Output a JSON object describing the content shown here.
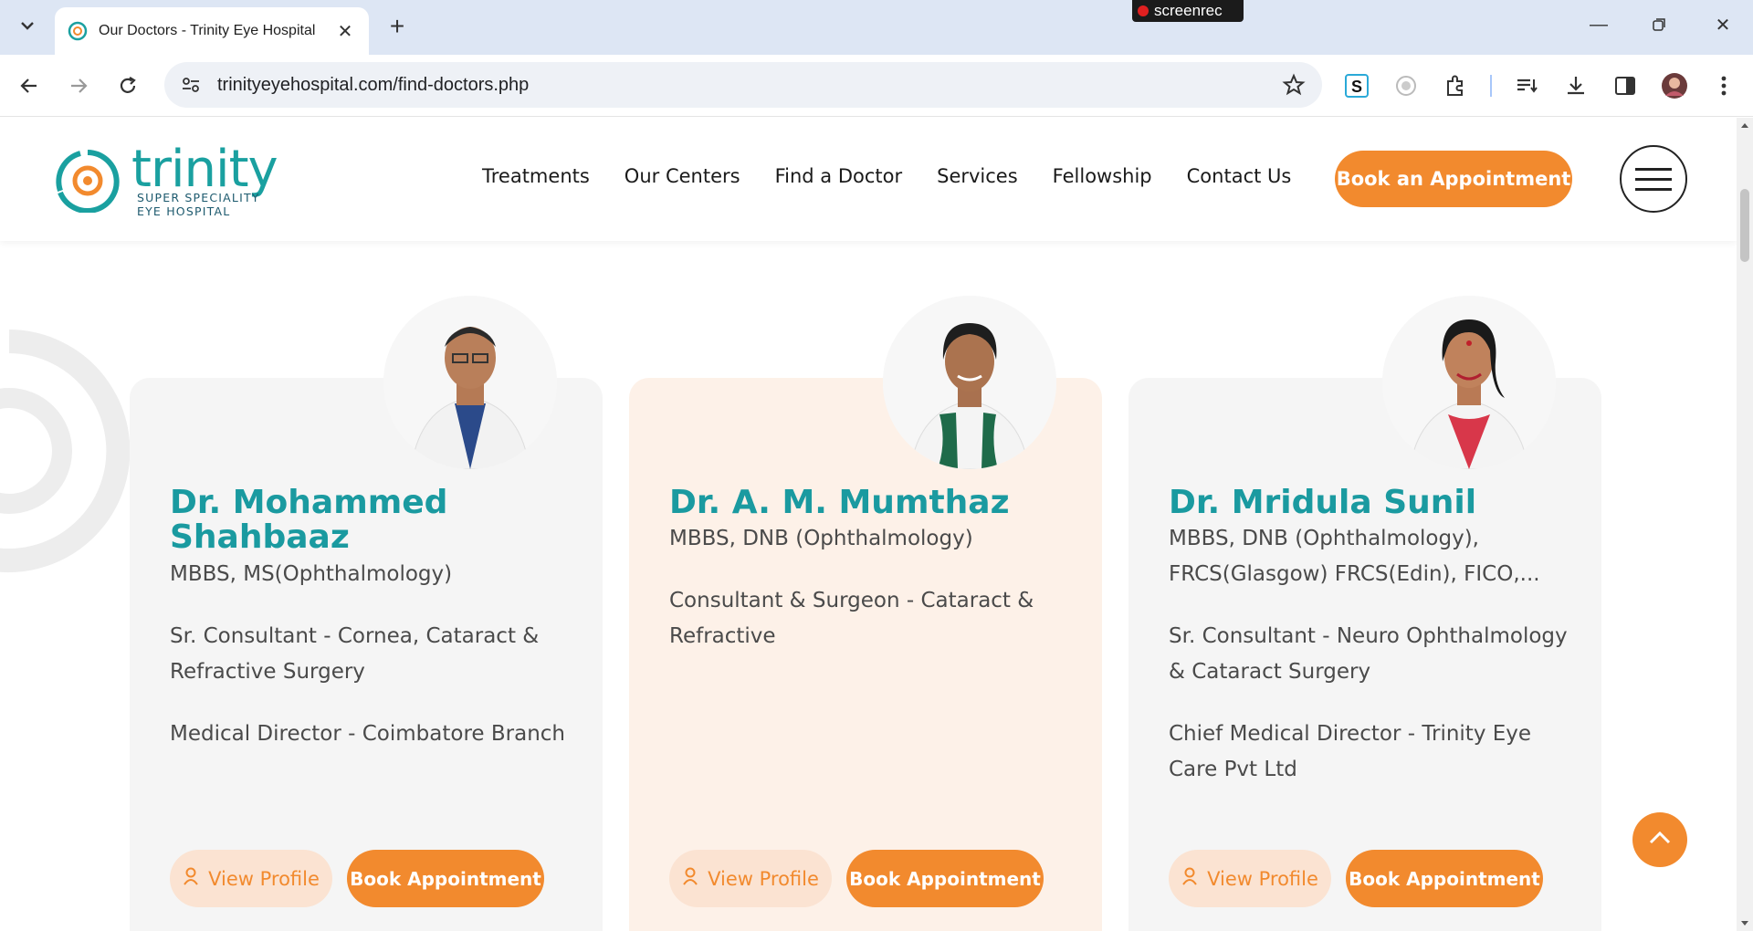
{
  "browser": {
    "tab_title": "Our Doctors - Trinity Eye Hospital",
    "url": "trinityeyehospital.com/find-doctors.php",
    "recorder_label": "screenrec",
    "new_tab_symbol": "+"
  },
  "header": {
    "logo_word": "trinity",
    "logo_sub1": "SUPER SPECIALITY",
    "logo_sub2": "EYE HOSPITAL",
    "nav": [
      "Treatments",
      "Our Centers",
      "Find a Doctor",
      "Services",
      "Fellowship",
      "Contact Us"
    ],
    "cta": "Book an Appointment"
  },
  "doctors": [
    {
      "name": "Dr. Mohammed Shahbaaz",
      "qualification": "MBBS, MS(Ophthalmology)",
      "role": "Sr. Consultant - Cornea, Cataract & Refractive Surgery",
      "extra": "Medical Director - Coimbatore Branch"
    },
    {
      "name": "Dr. A. M. Mumthaz",
      "qualification": "MBBS, DNB (Ophthalmology)",
      "role": "Consultant & Surgeon - Cataract & Refractive",
      "extra": ""
    },
    {
      "name": "Dr. Mridula Sunil",
      "qualification": "MBBS, DNB (Ophthalmology), FRCS(Glasgow) FRCS(Edin), FICO,...",
      "role": "Sr. Consultant - Neuro Ophthalmology & Cataract Surgery",
      "extra": "Chief Medical Director - Trinity Eye Care Pvt Ltd"
    }
  ],
  "buttons": {
    "view_profile": "View Profile",
    "book_appointment": "Book Appointment"
  },
  "colors": {
    "brand_teal": "#1a9aa0",
    "brand_orange": "#f28a2e",
    "card_grey": "#f5f5f5",
    "card_peach": "#fdf1e8"
  },
  "icons": [
    "tab-list-icon",
    "favicon-icon",
    "close-icon",
    "back-icon",
    "forward-icon",
    "reload-icon",
    "site-settings-icon",
    "star-icon",
    "extension-s-icon",
    "extension-record-icon",
    "extensions-icon",
    "reading-list-icon",
    "download-icon",
    "side-panel-icon",
    "profile-avatar",
    "more-menu-icon",
    "user-icon",
    "chevron-up-icon"
  ]
}
